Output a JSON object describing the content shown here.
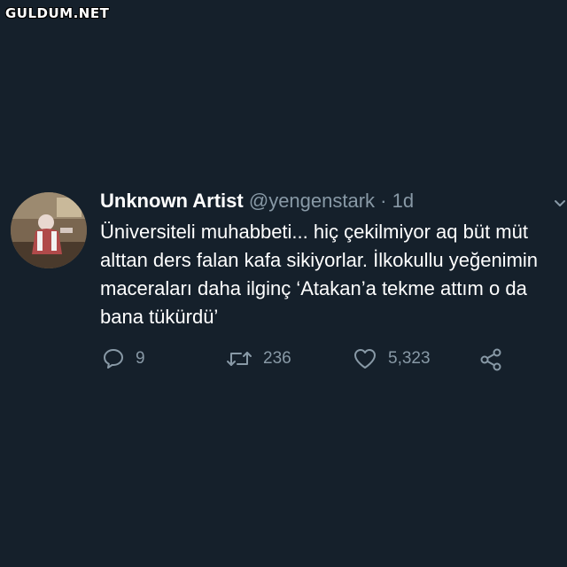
{
  "watermark": "GULDUM.NET",
  "tweet": {
    "display_name": "Unknown Artist",
    "handle": "@yengenstark",
    "separator": "·",
    "time": "1d",
    "text": "Üniversiteli muhabbeti... hiç çekilmiyor aq büt müt alttan ders falan kafa sikiyorlar. İlkokullu yeğenimin maceraları daha ilginç ‘Atakan’a tekme attım o da bana tükürdü’"
  },
  "actions": {
    "reply_count": "9",
    "retweet_count": "236",
    "like_count": "5,323",
    "icons": [
      "reply-icon",
      "retweet-icon",
      "heart-icon",
      "share-icon"
    ]
  },
  "colors": {
    "background": "#15202b",
    "secondary_text": "#8899a6",
    "primary_text": "#ffffff"
  }
}
